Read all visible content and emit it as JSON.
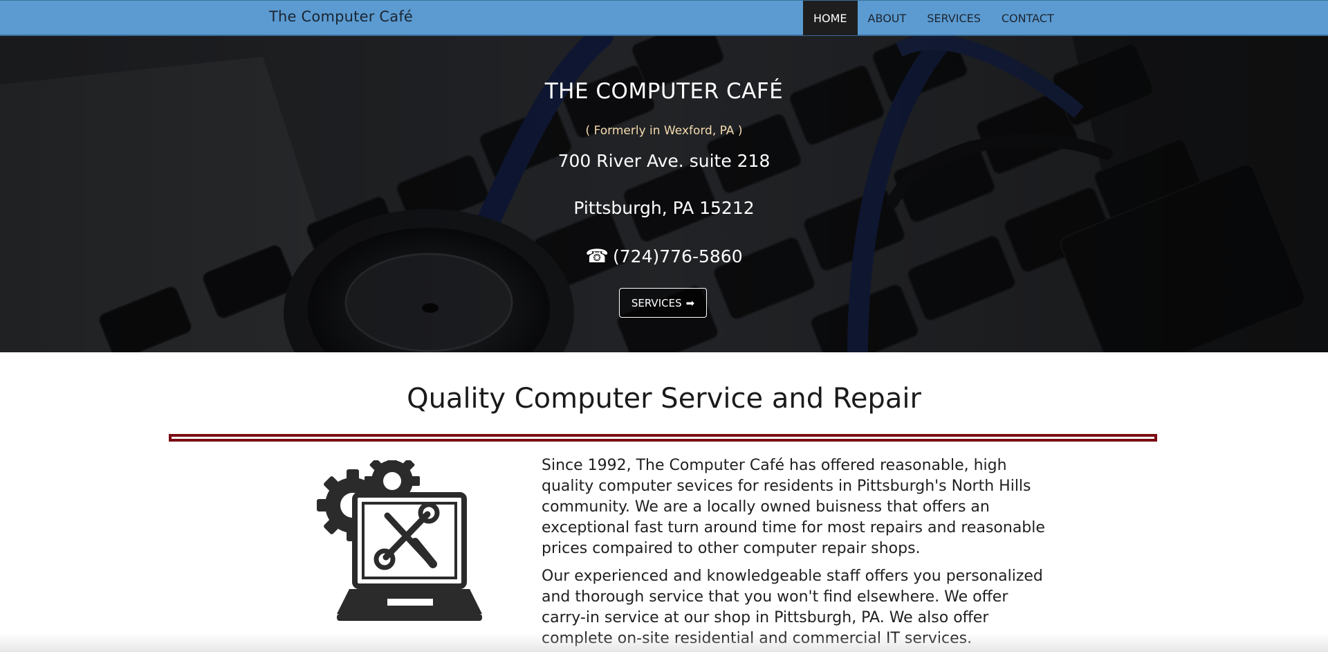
{
  "nav": {
    "brand": "The Computer Café",
    "items": [
      {
        "label": "HOME",
        "active": true
      },
      {
        "label": "ABOUT",
        "active": false
      },
      {
        "label": "SERVICES",
        "active": false
      },
      {
        "label": "CONTACT",
        "active": false
      }
    ]
  },
  "hero": {
    "title": "THE COMPUTER CAFÉ",
    "former": "( Formerly in Wexford, PA )",
    "address_line1": "700 River Ave. suite 218",
    "address_line2": "Pittsburgh, PA 15212",
    "phone_icon": "☎",
    "phone": "(724)776-5860",
    "button_label": "SERVICES",
    "button_icon": "➡"
  },
  "main": {
    "title": "Quality Computer Service and Repair",
    "paragraph1": "Since 1992, The Computer Café has offered reasonable, high quality computer sevices for residents in Pittsburgh's North Hills community. We are a locally owned buisness that offers an exceptional fast turn around time for most repairs and reasonable prices compaired to other computer repair shops.",
    "paragraph2": "Our experienced and knowledgeable staff offers you personalized and thorough service that you won't find elsewhere. We offer carry-in service at our shop in Pittsburgh, PA. We also offer complete on-site residential and commercial IT services."
  },
  "colors": {
    "navbar": "#5b9bd1",
    "active_nav": "#1e1e1e",
    "divider": "#7a0d13",
    "former_text": "#f5dcb0"
  }
}
